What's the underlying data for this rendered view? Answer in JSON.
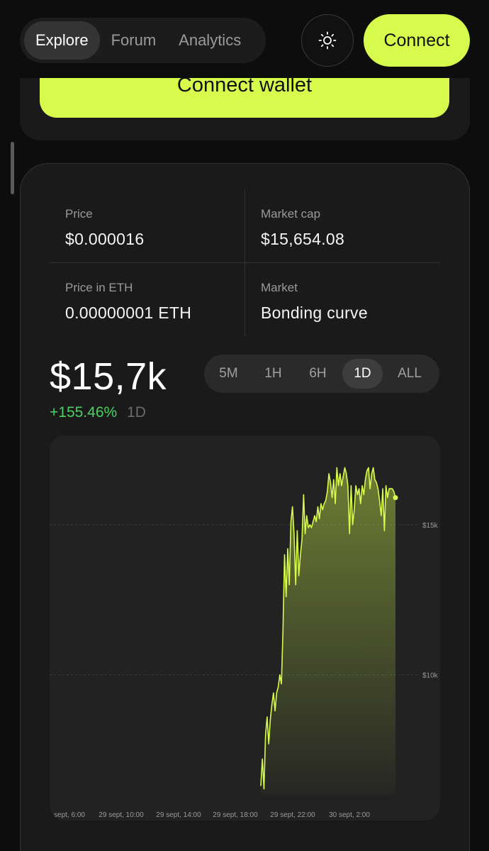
{
  "nav": {
    "tabs": [
      {
        "label": "Explore",
        "active": true
      },
      {
        "label": "Forum",
        "active": false
      },
      {
        "label": "Analytics",
        "active": false
      }
    ],
    "theme_icon": "sun-icon",
    "connect_label": "Connect"
  },
  "wallet": {
    "button_label": "Connect wallet"
  },
  "stats": {
    "price_label": "Price",
    "price_value": "$0.000016",
    "market_cap_label": "Market cap",
    "market_cap_value": "$15,654.08",
    "price_eth_label": "Price in ETH",
    "price_eth_value": "0.00000001 ETH",
    "market_label": "Market",
    "market_value": "Bonding curve"
  },
  "summary": {
    "value": "$15,7k",
    "change": "+155.46%",
    "period": "1D"
  },
  "range": {
    "options": [
      "5M",
      "1H",
      "6H",
      "1D",
      "ALL"
    ],
    "selected": "1D"
  },
  "colors": {
    "accent": "#d7fb4c",
    "positive": "#4bd163",
    "background": "#0d0d0d",
    "card": "#1a1a1a"
  },
  "chart_data": {
    "type": "area",
    "x_tick_labels": [
      "sept, 6:00",
      "29 sept, 10:00",
      "29 sept, 14:00",
      "29 sept, 18:00",
      "29 sept, 22:00",
      "30 sept, 2:00"
    ],
    "y_tick_labels": [
      "$15k",
      "$10k"
    ],
    "ylim": [
      6000,
      17500
    ],
    "grid": true,
    "series": [
      {
        "x": [
          0.0,
          0.1,
          0.2,
          0.3,
          0.4,
          0.5,
          0.6,
          0.7,
          0.8,
          0.9,
          1.0,
          1.1,
          1.2,
          1.3,
          1.4,
          1.5,
          1.6,
          1.7,
          1.8,
          1.9,
          2.0,
          2.1,
          2.2,
          2.3,
          2.4,
          2.5,
          2.6,
          2.7,
          2.8,
          2.9,
          3.0,
          3.1,
          3.2,
          3.3,
          3.4,
          3.5,
          3.6,
          3.7,
          3.8,
          3.9,
          4.0,
          4.1,
          4.2,
          4.3,
          4.4,
          4.5,
          4.6,
          4.7,
          4.8,
          4.9,
          5.0,
          5.1,
          5.2,
          5.3,
          5.4,
          5.5,
          5.6,
          5.7,
          5.8,
          5.9,
          6.0,
          6.1,
          6.2,
          6.3,
          6.4,
          6.5,
          6.6,
          6.7,
          6.8,
          6.9,
          7.0,
          7.1,
          7.2,
          7.3,
          7.4,
          7.5,
          7.6,
          7.7,
          7.8,
          7.9,
          8.0,
          8.1,
          8.2,
          8.3,
          8.4,
          8.5
        ],
        "values": [
          6300,
          7200,
          6200,
          8000,
          8600,
          7700,
          8500,
          9000,
          9400,
          8800,
          9400,
          9600,
          10000,
          9700,
          11500,
          14000,
          12600,
          14200,
          13000,
          15100,
          15600,
          14700,
          13000,
          14800,
          13300,
          14000,
          14500,
          16000,
          14700,
          15300,
          14900,
          15000,
          14900,
          15100,
          15300,
          15100,
          15600,
          15200,
          15700,
          15500,
          15700,
          15800,
          16100,
          16700,
          16400,
          15900,
          16500,
          15700,
          16900,
          16300,
          16700,
          16300,
          16600,
          16900,
          16700,
          16300,
          14700,
          16300,
          15000,
          15500,
          16300,
          16000,
          16200,
          15700,
          16300,
          16000,
          16500,
          16800,
          16900,
          16200,
          16700,
          16900,
          16500,
          16400,
          16200,
          15800,
          15300,
          16200,
          14800,
          16300,
          15900,
          16200,
          16200,
          16200,
          16100,
          15900
        ]
      }
    ]
  }
}
